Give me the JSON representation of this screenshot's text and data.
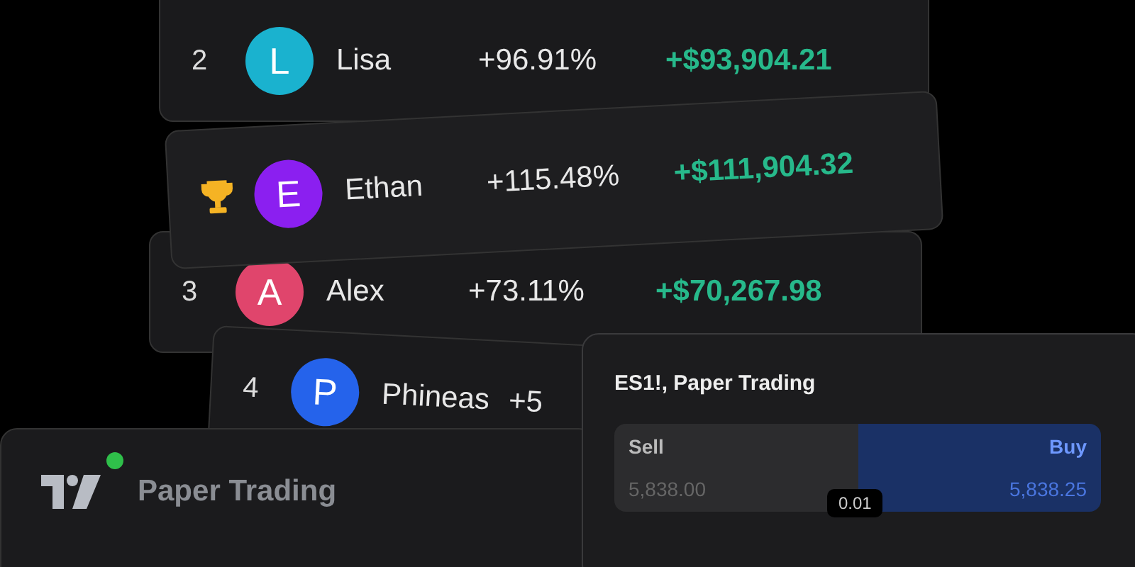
{
  "leaderboard": [
    {
      "kind": "rank",
      "rank": "2",
      "initial": "L",
      "color": "#1ab2cf",
      "name": "Lisa",
      "return": "+96.91%",
      "profit": "+$93,904.21"
    },
    {
      "kind": "trophy",
      "initial": "E",
      "color": "#8b1ff0",
      "name": "Ethan",
      "return": "+115.48%",
      "profit": "+$111,904.32"
    },
    {
      "kind": "rank",
      "rank": "3",
      "initial": "A",
      "color": "#e0456c",
      "name": "Alex",
      "return": "+73.11%",
      "profit": "+$70,267.98"
    },
    {
      "kind": "rank",
      "rank": "4",
      "initial": "P",
      "color": "#2563eb",
      "name": "Phineas",
      "return": "+5"
    }
  ],
  "account": {
    "label": "Paper Trading",
    "online": true
  },
  "order_panel": {
    "title": "ES1!, Paper Trading",
    "sell": {
      "label": "Sell",
      "price": "5,838.00"
    },
    "spread": "0.01",
    "buy": {
      "label": "Buy",
      "price": "5,838.25"
    }
  }
}
